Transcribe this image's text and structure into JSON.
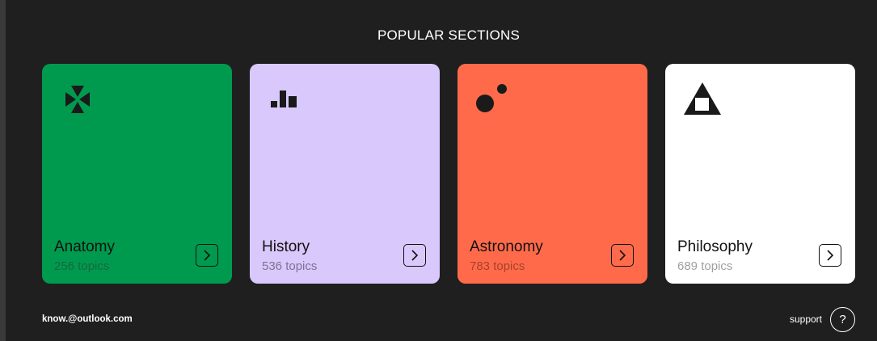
{
  "header": {
    "title": "POPULAR SECTIONS"
  },
  "cards": [
    {
      "name": "Anatomy",
      "count": "256 topics",
      "background": "#009a4e",
      "count_color": "#14693e",
      "icon": "star-cross-icon"
    },
    {
      "name": "History",
      "count": "536 topics",
      "background": "#d9c8fb",
      "count_color": "#7b7394",
      "icon": "bar-chart-icon"
    },
    {
      "name": "Astronomy",
      "count": "783 topics",
      "background": "#ff6b4a",
      "count_color": "#a8412b",
      "icon": "planets-icon"
    },
    {
      "name": "Philosophy",
      "count": "689 topics",
      "background": "#ffffff",
      "count_color": "#a0a0a0",
      "icon": "triangle-square-icon"
    }
  ],
  "footer": {
    "email": "know.@outlook.com",
    "support_label": "support",
    "support_icon": "?"
  }
}
